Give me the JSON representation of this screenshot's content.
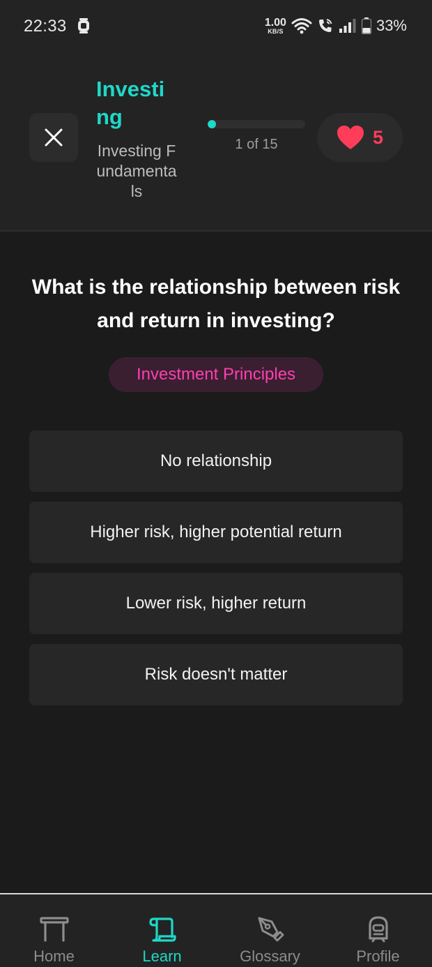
{
  "status_bar": {
    "time": "22:33",
    "net_speed_value": "1.00",
    "net_speed_unit": "KB/S",
    "battery": "33%"
  },
  "header": {
    "lesson_title": "Investing",
    "lesson_subtitle": "Investing Fundamentals",
    "progress_text": "1 of 15",
    "progress_current": 1,
    "progress_total": 15,
    "lives": "5"
  },
  "question": {
    "text": "What is the relationship between risk and return in investing?",
    "category": "Investment Principles"
  },
  "options": [
    "No relationship",
    "Higher risk, higher potential return",
    "Lower risk, higher return",
    "Risk doesn't matter"
  ],
  "nav": {
    "items": [
      {
        "label": "Home",
        "icon": "home-icon"
      },
      {
        "label": "Learn",
        "icon": "scroll-icon"
      },
      {
        "label": "Glossary",
        "icon": "pen-nib-icon"
      },
      {
        "label": "Profile",
        "icon": "profile-icon"
      }
    ],
    "active": "Learn"
  },
  "colors": {
    "accent": "#1fd8c8",
    "heart": "#ff3d5a",
    "category": "#ff3fb0",
    "background": "#1b1b1b"
  }
}
